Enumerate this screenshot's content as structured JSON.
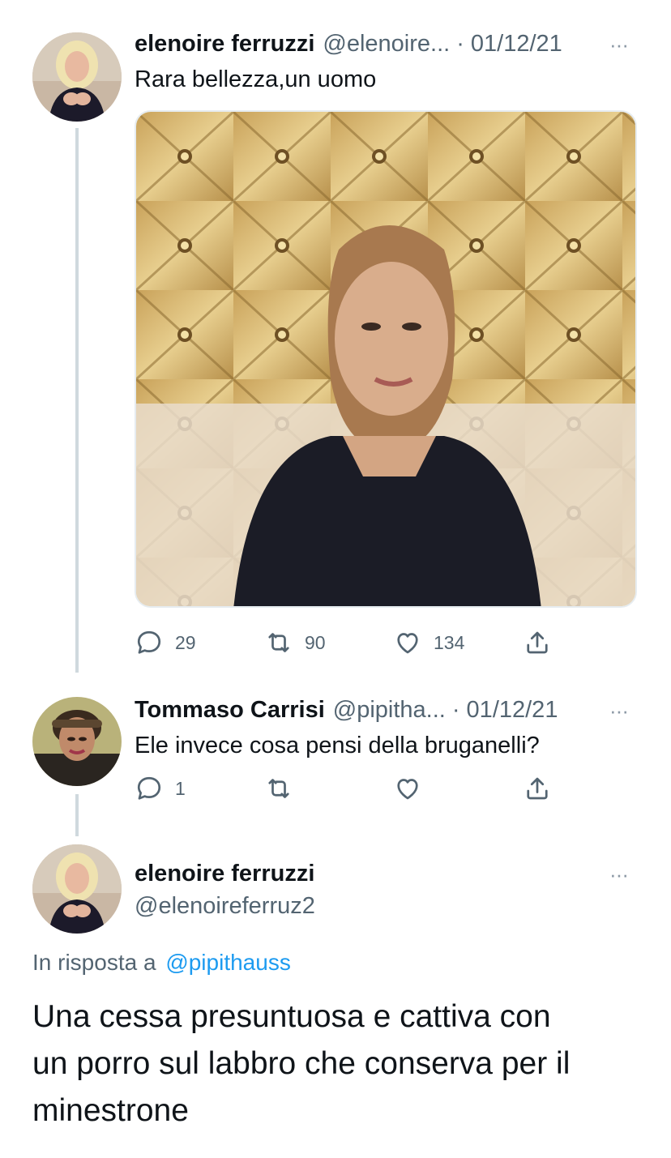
{
  "tweets": [
    {
      "name": "elenoire ferruzzi",
      "handle": "@elenoire...",
      "date": "· 01/12/21",
      "text": "Rara bellezza,un uomo",
      "replies": "29",
      "retweets": "90",
      "likes": "134"
    },
    {
      "name": "Tommaso Carrisi",
      "handle": "@pipitha...",
      "date": "· 01/12/21",
      "text": "Ele invece cosa pensi della bruganelli?",
      "replies": "1",
      "retweets": "",
      "likes": ""
    }
  ],
  "main": {
    "name": "elenoire ferruzzi",
    "handle": "@elenoireferruz2",
    "reply_prefix": "In risposta a",
    "reply_to": "@pipithauss",
    "text_lines": [
      "Una cessa presuntuosa e cattiva con",
      "un porro sul labbro che conserva per il",
      "minestrone"
    ]
  },
  "more_glyph": "···",
  "icons": [
    "reply-icon",
    "retweet-icon",
    "like-icon",
    "share-icon",
    "more-icon"
  ],
  "colors": {
    "link": "#1d9bf0",
    "secondary": "#536471",
    "thread_line": "#cfd9de"
  }
}
